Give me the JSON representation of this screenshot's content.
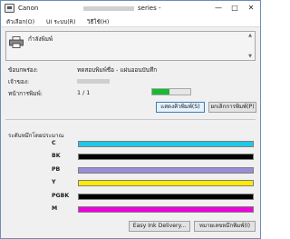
{
  "window": {
    "title": "Canon",
    "title_suffix": "series -"
  },
  "menu": {
    "items": [
      "ตัวเลือก(O)",
      "UI ระบบ(R)",
      "วิธีใช้(H)"
    ]
  },
  "message": {
    "text": "กำลังพิมพ์"
  },
  "info": {
    "rows": [
      {
        "label": "ข้อบกพร่อง:",
        "value": "ทดสอบพิมพ์ชื่อ - แผ่นออนบันทึก"
      },
      {
        "label": "เจ้าของ:",
        "value": ""
      },
      {
        "label": "หน้าการพิมพ์:",
        "value": "1 / 1"
      }
    ],
    "progress_fraction": 0.45,
    "progress_color": "#18b935"
  },
  "buttons": {
    "show_queue": "แสดงคิวพิมพ์(S)",
    "cancel_print": "ยกเลิกการพิมพ์(P)",
    "easy_ink": "Easy Ink Delivery...",
    "ink_details": "หมายเลขหมึกพิมพ์(I)"
  },
  "ink": {
    "section_label": "ระดับหมึกโดยประมาณ",
    "cartridges": [
      {
        "name": "C",
        "color": "#1ec8e6",
        "icon": "cyan-ink-bar"
      },
      {
        "name": "BK",
        "color": "#000000",
        "icon": "black-ink-bar"
      },
      {
        "name": "PB",
        "color": "#9b8cd8",
        "icon": "photo-blue-ink-bar"
      },
      {
        "name": "Y",
        "color": "#ffea00",
        "icon": "yellow-ink-bar"
      },
      {
        "name": "PGBK",
        "color": "#000000",
        "icon": "pigment-black-ink-bar"
      },
      {
        "name": "M",
        "color": "#ee00dc",
        "icon": "magenta-ink-bar"
      }
    ]
  }
}
